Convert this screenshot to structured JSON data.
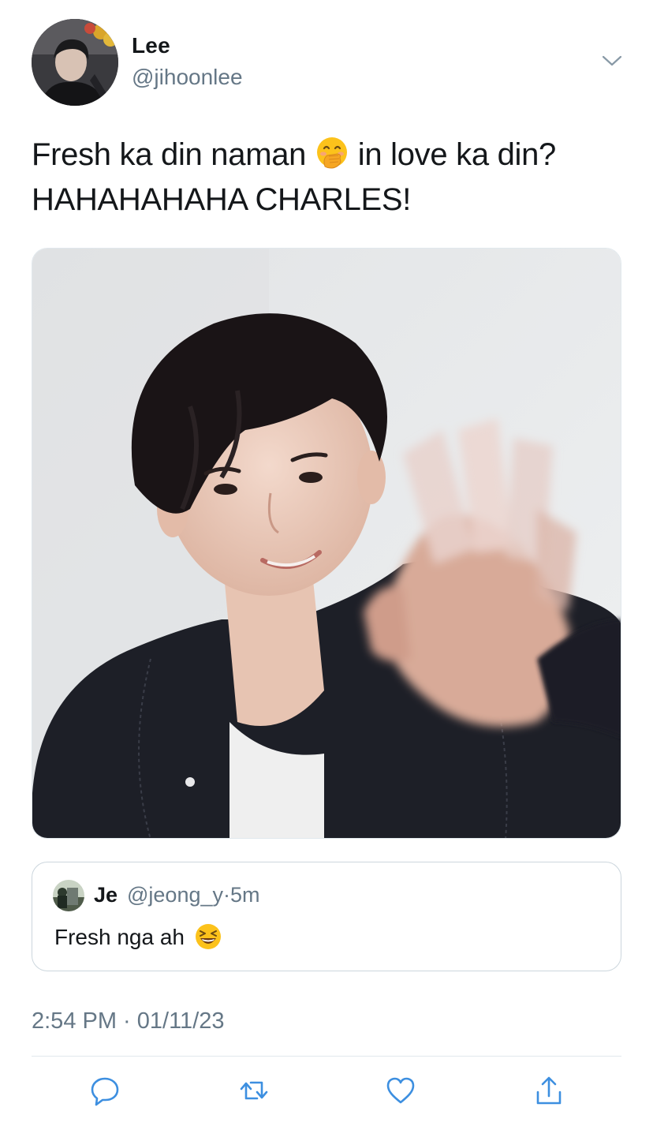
{
  "author": {
    "display_name": "Lee",
    "handle": "@jihoonlee"
  },
  "tweet": {
    "text_part1": "Fresh ka din naman",
    "text_part2": "in love ka din?",
    "text_line2": "HAHAHAHAHA CHARLES!",
    "emoji_1": "face-with-hand-over-mouth-emoji"
  },
  "quoted_tweet": {
    "name": "Je",
    "handle_and_time": "@jeong_y·5m",
    "text": "Fresh nga ah",
    "emoji": "grinning-squinting-face-emoji"
  },
  "timestamp": "2:54 PM · 01/11/23",
  "actions": {
    "reply_icon": "speech-bubble-icon",
    "retweet_icon": "retweet-arrows-icon",
    "like_icon": "heart-icon",
    "share_icon": "share-upload-icon"
  },
  "colors": {
    "text_primary": "#14171a",
    "text_secondary": "#657786",
    "border": "#ccd6dd"
  }
}
